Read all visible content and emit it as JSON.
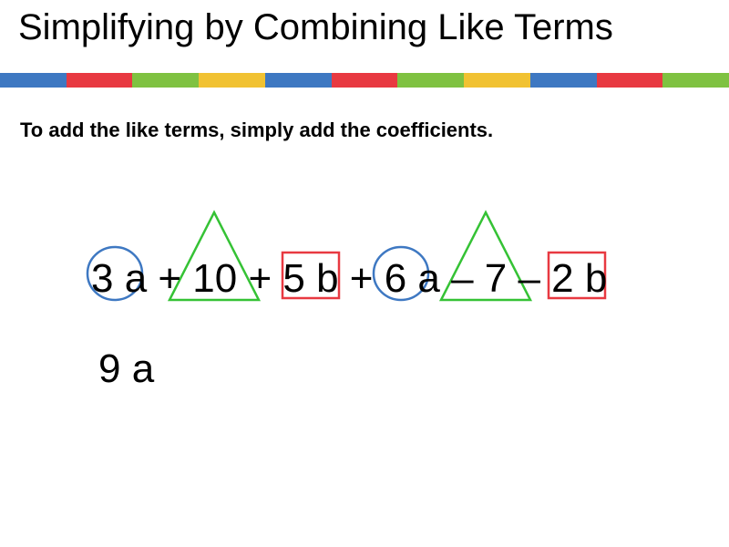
{
  "title": "Simplifying by Combining Like Terms",
  "instruction": "To add the like terms, simply add the coefficients.",
  "expression": "3 a + 10 + 5 b + 6 a – 7 – 2 b",
  "answer": "9 a",
  "stripe_colors": [
    "#3E78C2",
    "#E83941",
    "#7FC241",
    "#F1C232",
    "#3E78C2",
    "#E83941",
    "#7FC241",
    "#F1C232",
    "#3E78C2",
    "#E83941",
    "#7FC241"
  ],
  "shapes": {
    "circle_color": "#3E78C2",
    "triangle_color": "#35C235",
    "square_color": "#E83941"
  }
}
